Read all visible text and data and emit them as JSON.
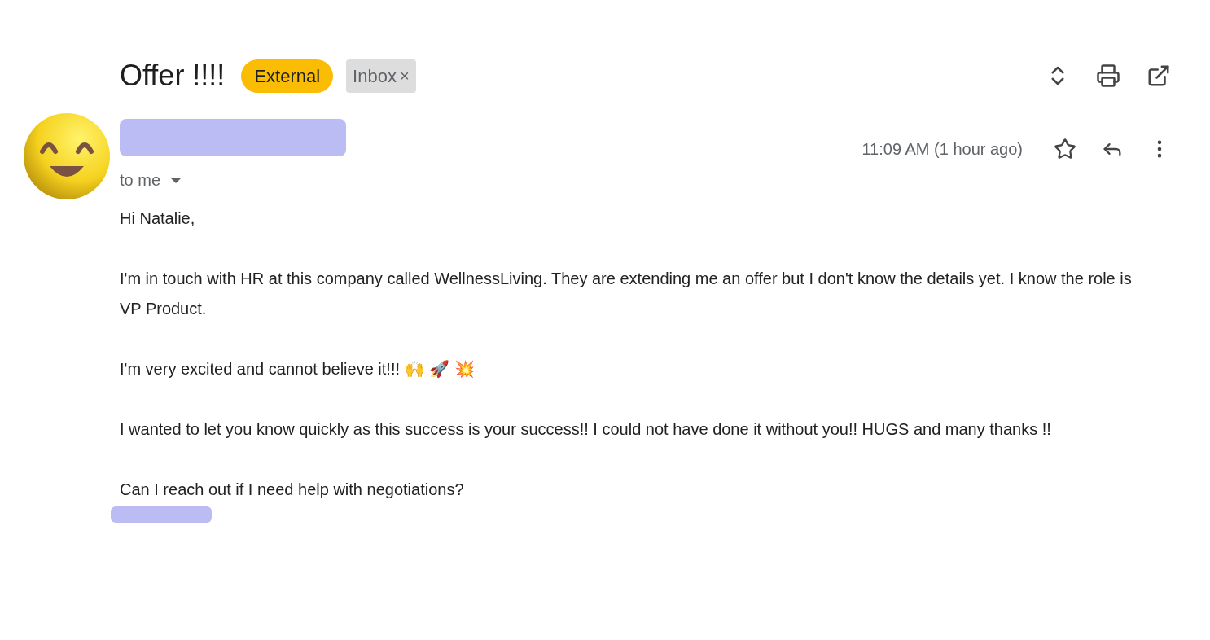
{
  "subject": "Offer !!!!",
  "labels": [
    {
      "kind": "external",
      "text": "External"
    },
    {
      "kind": "inbox",
      "text": "Inbox",
      "remove": "×"
    }
  ],
  "sender": {
    "recipient": "to me",
    "time": "11:09 AM (1 hour ago)",
    "starred": false
  },
  "body": [
    "Hi Natalie,",
    "I'm in touch with HR at this company called WellnessLiving. They are extending me an offer but I don't know the details yet. I know the role is VP Product.",
    "I'm very excited and cannot believe it!!! 🙌 🚀 💥",
    "I wanted to let you know quickly as this success is your success!! I could not have done it without you!! HUGS and many thanks !!",
    "Can I reach out if I need help with negotiations?"
  ]
}
